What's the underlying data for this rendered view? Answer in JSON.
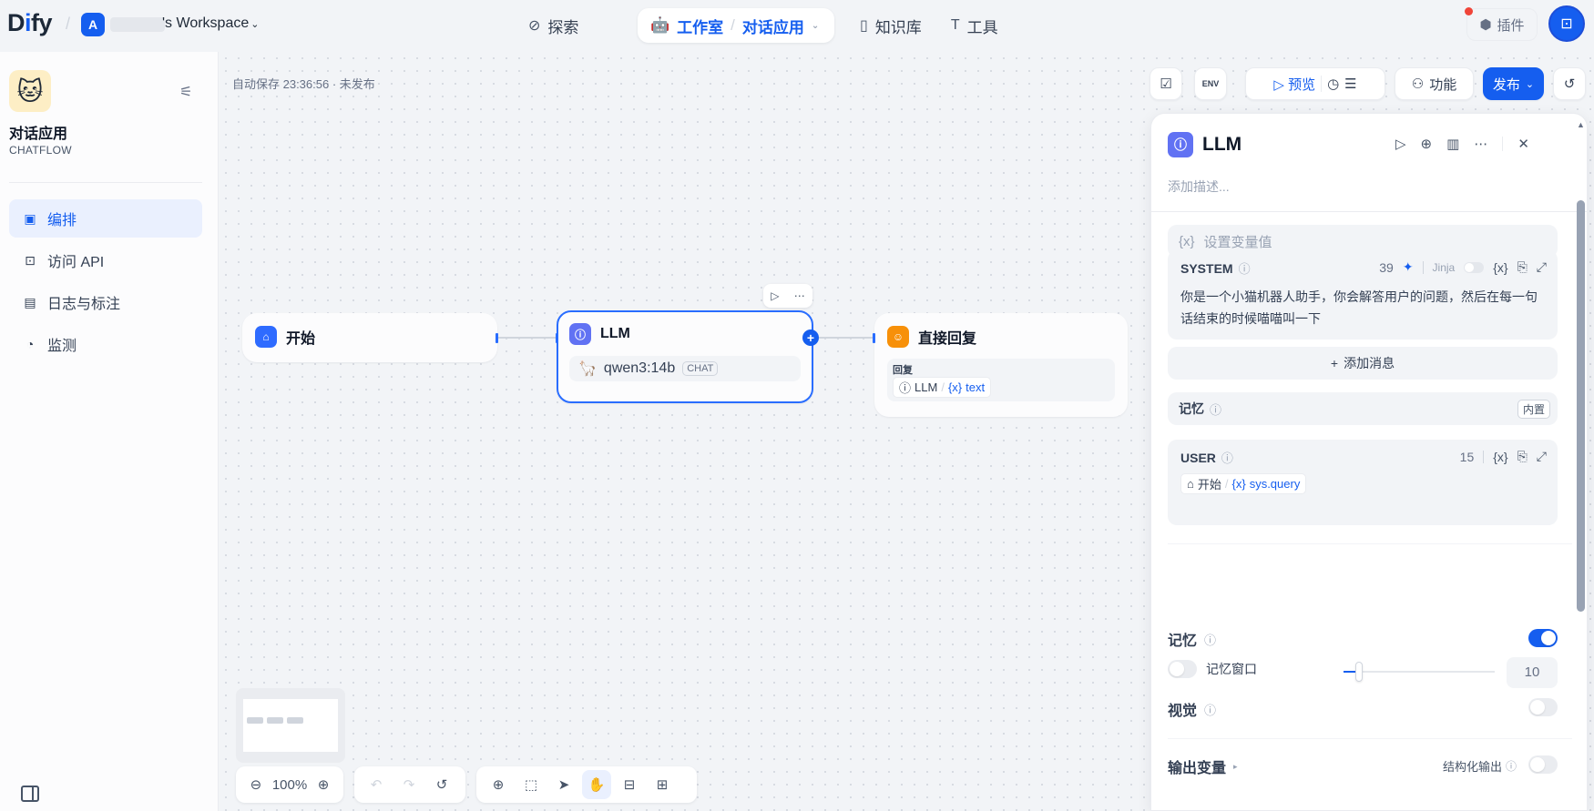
{
  "top": {
    "logo_a": "D",
    "logo_b": "i",
    "logo_c": "fy",
    "workspace_initial": "A",
    "workspace_name": "'s Workspace",
    "nav": {
      "explore": "探索",
      "studio": "工作室",
      "app": "对话应用",
      "knowledge": "知识库",
      "tools": "工具"
    },
    "plugins": "插件"
  },
  "sidebar": {
    "app_name": "对话应用",
    "app_type": "CHATFLOW",
    "items": [
      {
        "label": "编排",
        "icon": "layout-icon"
      },
      {
        "label": "访问 API",
        "icon": "terminal-icon"
      },
      {
        "label": "日志与标注",
        "icon": "log-icon"
      },
      {
        "label": "监测",
        "icon": "gauge-icon"
      }
    ]
  },
  "canvas": {
    "autosave": "自动保存 23:36:56 · 未发布",
    "nodes": {
      "start": {
        "title": "开始"
      },
      "llm": {
        "title": "LLM",
        "model": "qwen3:14b",
        "mode": "CHAT"
      },
      "answer": {
        "title": "直接回复",
        "reply_label": "回复",
        "var_node": "LLM",
        "var_name": "text"
      }
    },
    "zoom": "100%"
  },
  "toolbar": {
    "preview": "预览",
    "features": "功能",
    "publish": "发布",
    "env": "ENV"
  },
  "panel": {
    "title": "LLM",
    "desc_placeholder": "添加描述...",
    "context_placeholder": "设置变量值",
    "system": {
      "label": "SYSTEM",
      "count": "39",
      "jinja": "Jinja",
      "text": "你是一个小猫机器人助手，你会解答用户的问题，然后在每一句话结束的时候喵喵叫一下"
    },
    "add_message": "添加消息",
    "memory_label": "记忆",
    "builtin": "内置",
    "user": {
      "label": "USER",
      "count": "15",
      "var_node": "开始",
      "var_name": "sys.query"
    },
    "memory_section": "记忆",
    "memory_enabled": true,
    "memory_window_label": "记忆窗口",
    "memory_window_enabled": false,
    "memory_window_value": "10",
    "memory_window_fraction": 0.1,
    "vision_label": "视觉",
    "vision_enabled": false,
    "output_vars": "输出变量",
    "structured_output": "结构化输出",
    "structured_output_enabled": false
  },
  "colors": {
    "primary": "#155eef",
    "llm_icon": "#6172f3",
    "start_icon": "#2e6bff",
    "answer_icon": "#f79009"
  }
}
